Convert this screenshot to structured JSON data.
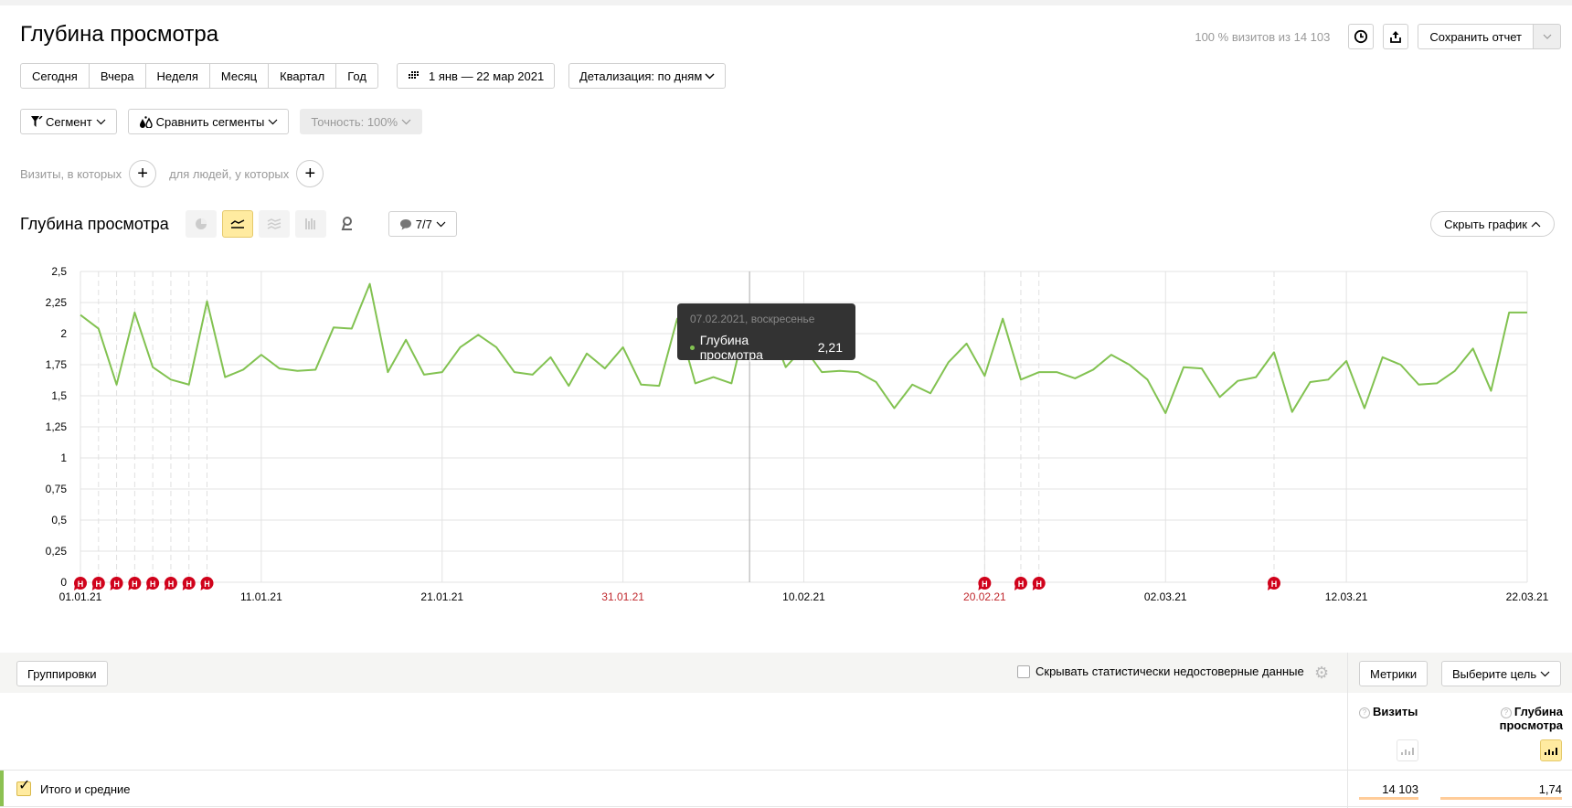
{
  "page": {
    "title": "Глубина просмотра",
    "visits_info": "100 % визитов из 14 103",
    "save_report": "Сохранить отчет"
  },
  "toolbar": {
    "periods": [
      "Сегодня",
      "Вчера",
      "Неделя",
      "Месяц",
      "Квартал",
      "Год"
    ],
    "date_range": "1 янв — 22 мар 2021",
    "detail": "Детализация: по дням",
    "segment": "Сегмент",
    "compare": "Сравнить сегменты",
    "accuracy": "Точность: 100%"
  },
  "filters": {
    "visits_label": "Визиты, в которых",
    "people_label": "для людей, у которых"
  },
  "chart_header": {
    "title": "Глубина просмотра",
    "notes_count": "7/7",
    "hide_chart": "Скрыть график"
  },
  "tooltip": {
    "date": "07.02.2021, воскресенье",
    "metric": "Глубина просмотра",
    "value": "2,21"
  },
  "chart_data": {
    "type": "line",
    "title": "Глубина просмотра",
    "xlabel": "",
    "ylabel": "",
    "ylim": [
      0,
      2.5
    ],
    "y_ticks": [
      "0",
      "0,25",
      "0,5",
      "0,75",
      "1",
      "1,25",
      "1,5",
      "1,75",
      "2",
      "2,25",
      "2,5"
    ],
    "x_start": "2021-01-01",
    "x_end": "2021-03-22",
    "x_ticks": [
      {
        "label": "01.01.21",
        "day": 0,
        "holiday": false
      },
      {
        "label": "11.01.21",
        "day": 10,
        "holiday": false
      },
      {
        "label": "21.01.21",
        "day": 20,
        "holiday": false
      },
      {
        "label": "31.01.21",
        "day": 30,
        "holiday": true
      },
      {
        "label": "10.02.21",
        "day": 40,
        "holiday": false
      },
      {
        "label": "20.02.21",
        "day": 50,
        "holiday": true
      },
      {
        "label": "02.03.21",
        "day": 60,
        "holiday": false
      },
      {
        "label": "12.03.21",
        "day": 70,
        "holiday": false
      },
      {
        "label": "22.03.21",
        "day": 80,
        "holiday": false
      }
    ],
    "grid": true,
    "series": [
      {
        "name": "Глубина просмотра",
        "color": "#82c251",
        "values": [
          2.15,
          2.04,
          1.59,
          2.17,
          1.73,
          1.63,
          1.59,
          2.26,
          1.65,
          1.71,
          1.83,
          1.72,
          1.7,
          1.71,
          2.05,
          2.04,
          2.4,
          1.69,
          1.95,
          1.67,
          1.69,
          1.89,
          1.99,
          1.89,
          1.69,
          1.67,
          1.81,
          1.58,
          1.84,
          1.72,
          1.89,
          1.59,
          1.58,
          2.12,
          1.6,
          1.65,
          1.6,
          2.21,
          2.1,
          1.73,
          1.89,
          1.69,
          1.7,
          1.69,
          1.61,
          1.4,
          1.59,
          1.52,
          1.77,
          1.92,
          1.66,
          2.12,
          1.63,
          1.69,
          1.69,
          1.64,
          1.71,
          1.83,
          1.75,
          1.63,
          1.36,
          1.73,
          1.72,
          1.49,
          1.62,
          1.65,
          1.85,
          1.37,
          1.61,
          1.63,
          1.78,
          1.4,
          1.81,
          1.75,
          1.59,
          1.6,
          1.7,
          1.88,
          1.54,
          2.17,
          2.17
        ]
      }
    ],
    "hover_day": 37,
    "annotations": [
      {
        "day": 0,
        "label": "Н"
      },
      {
        "day": 1,
        "label": "Н"
      },
      {
        "day": 2,
        "label": "Н"
      },
      {
        "day": 3,
        "label": "Н"
      },
      {
        "day": 4,
        "label": "Н"
      },
      {
        "day": 5,
        "label": "Н"
      },
      {
        "day": 6,
        "label": "Н"
      },
      {
        "day": 7,
        "label": "Н"
      },
      {
        "day": 50,
        "label": "Н"
      },
      {
        "day": 52,
        "label": "Н"
      },
      {
        "day": 53,
        "label": "Н"
      },
      {
        "day": 66,
        "label": "Н"
      }
    ],
    "annotation_color": "#d0021b"
  },
  "table": {
    "groupings": "Группировки",
    "hide_stat": "Скрывать статистически недостоверные данные",
    "metrics": "Метрики",
    "goal": "Выберите цель",
    "columns": [
      {
        "label": "Визиты"
      },
      {
        "label": "Глубина просмотра"
      }
    ],
    "total_row": {
      "label": "Итого и средние",
      "values": [
        "14 103",
        "1,74"
      ]
    }
  }
}
